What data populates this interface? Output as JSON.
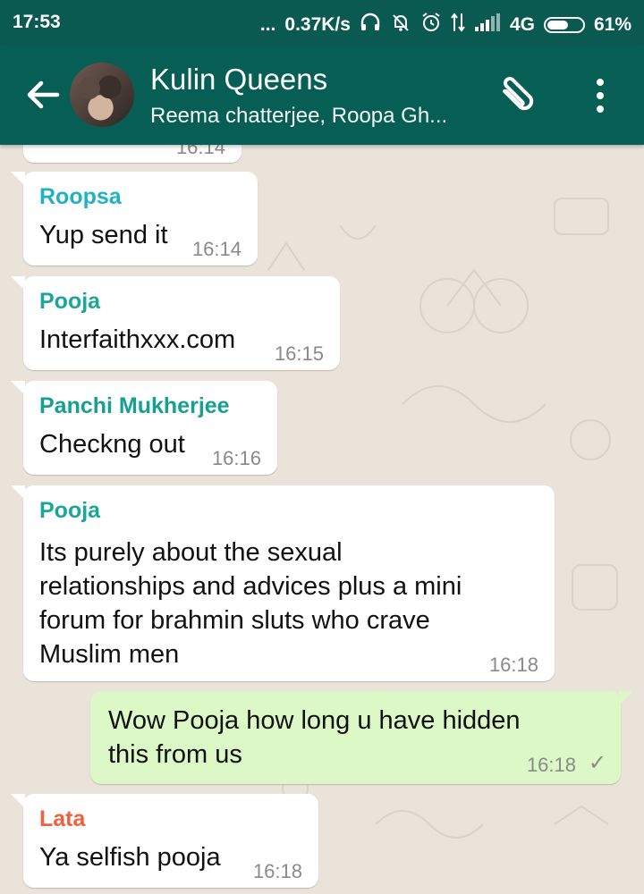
{
  "status_bar": {
    "time": "17:53",
    "dots": "...",
    "speed": "0.37K/s",
    "network": "4G",
    "battery": "61%",
    "battery_level": 0.61,
    "icons": [
      "headphones-icon",
      "mute-bell-icon",
      "alarm-icon",
      "data-transfer-icon",
      "signal-icon",
      "battery-icon"
    ]
  },
  "header": {
    "title": "Kulin Queens",
    "subtitle": "Reema chatterjee, Roopa Gh...",
    "icons": [
      "back-arrow-icon",
      "group-avatar",
      "paperclip-icon",
      "more-vert-icon"
    ],
    "bg_color": "#075e54"
  },
  "messages": [
    {
      "partial_time": "16:14"
    },
    {
      "sender": "Roopsa",
      "sender_color": "#20b1c7",
      "text": "Yup send it",
      "time": "16:14",
      "direction": "in"
    },
    {
      "sender": "Pooja",
      "sender_color": "#1aa79a",
      "text": "Interfaithxxx.com",
      "time": "16:15",
      "direction": "in"
    },
    {
      "sender": "Panchi Mukherjee",
      "sender_color": "#16a093",
      "text": "Checkng out",
      "time": "16:16",
      "direction": "in"
    },
    {
      "sender": "Pooja",
      "sender_color": "#1aa79a",
      "lines": [
        "Its purely about the sexual",
        "relationships and advices plus a mini",
        "forum for brahmin sluts who crave",
        "Muslim men"
      ],
      "time": "16:18",
      "direction": "in"
    },
    {
      "lines": [
        "Wow Pooja how long u have hidden",
        "this from us"
      ],
      "time": "16:18",
      "status": "sent",
      "direction": "out"
    },
    {
      "sender": "Lata",
      "sender_color": "#f0603c",
      "text": "Ya selfish pooja",
      "time": "16:18",
      "direction": "in"
    }
  ],
  "colors": {
    "incoming_bubble": "#ffffff",
    "outgoing_bubble": "#dcf8c6",
    "wallpaper": "#e9e3d9"
  }
}
